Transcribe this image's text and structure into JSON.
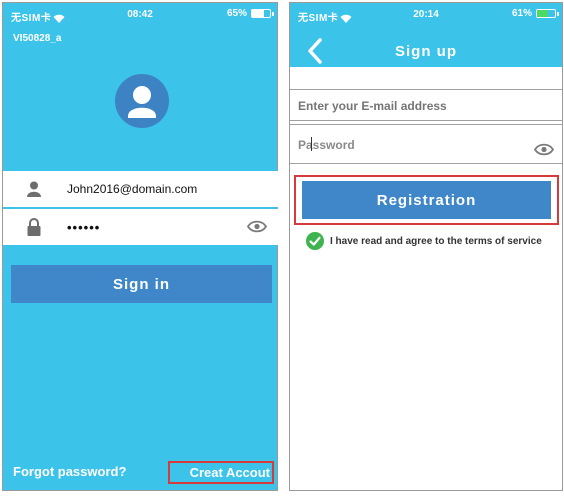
{
  "left": {
    "status": {
      "carrier": "无SIM卡",
      "time": "08:42",
      "battery": "65%"
    },
    "device_label": "VI50828_a",
    "email_value": "John2016@domain.com",
    "password_mask": "••••••",
    "signin_label": "Sign in",
    "forgot_label": "Forgot password?",
    "create_label": "Creat Accout"
  },
  "right": {
    "status": {
      "carrier": "无SIM卡",
      "time": "20:14",
      "battery": "61%"
    },
    "title": "Sign up",
    "email_placeholder": "Enter your E-mail address",
    "password_placeholder": "Password",
    "registration_label": "Registration",
    "agree_text": "I have read and agree to the terms of service"
  },
  "colors": {
    "sky": "#3cc3ea",
    "button_blue": "#3f87c9",
    "highlight_red": "#d73a3a",
    "check_green": "#3fb34f"
  },
  "icons": [
    "wifi-icon",
    "battery-icon",
    "avatar-icon",
    "user-icon",
    "lock-icon",
    "eye-icon",
    "back-arrow-icon",
    "checkmark-icon"
  ]
}
